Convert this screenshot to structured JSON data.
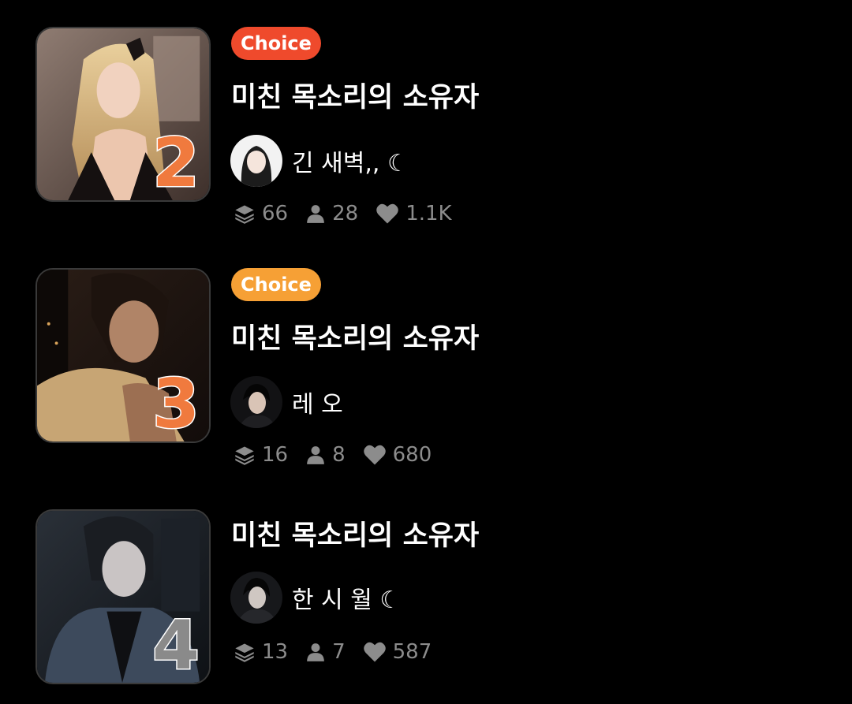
{
  "colors": {
    "background": "#000000",
    "rank_orange": "#f07a3e",
    "rank_gray": "#8a8a8a",
    "badge_red": "#ef4a2c",
    "badge_orange": "#f6a035",
    "stat_gray": "#8c8c8c"
  },
  "items": [
    {
      "rank": "2",
      "badge": "Choice",
      "title": "미친 목소리의 소유자",
      "author": "긴 새벽,, ☾",
      "stats": {
        "chapters": "66",
        "users": "28",
        "likes": "1.1K"
      }
    },
    {
      "rank": "3",
      "badge": "Choice",
      "title": "미친 목소리의 소유자",
      "author": "레 오",
      "stats": {
        "chapters": "16",
        "users": "8",
        "likes": "680"
      }
    },
    {
      "rank": "4",
      "badge": "",
      "title": "미친 목소리의 소유자",
      "author": "한 시 월 ☾",
      "stats": {
        "chapters": "13",
        "users": "7",
        "likes": "587"
      }
    }
  ],
  "icons": {
    "chapters": "layers-icon",
    "users": "person-icon",
    "likes": "heart-icon"
  }
}
